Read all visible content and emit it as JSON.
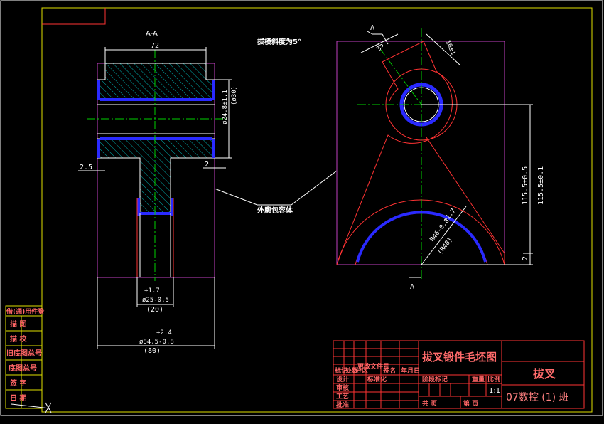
{
  "drawing": {
    "section_label": "A-A",
    "draft_note": "拔模斜度为5°",
    "envelope_note": "外廓包容体",
    "view_marker": "A"
  },
  "dimensions": {
    "top_width": "72",
    "diam_upper": "ø24.8±1.1",
    "diam_upper_ref": "(ø30)",
    "left_offset": "2.5",
    "right_offset": "2",
    "bore_tol": "+1.7",
    "bore_diam": "ø25-0.5",
    "bore_ref": "(20)",
    "outer_tol": "+2.4",
    "outer_diam": "ø84.5-0.8",
    "outer_ref": "(80)",
    "angle_left": "35",
    "angle_right": "10±1",
    "height_main": "115.5±0.5",
    "height_sub": "115.5±0.1",
    "radius_tol": "+1.7",
    "radius_main": "R46-0.8",
    "radius_ref": "(R48)",
    "bottom_offset": "2"
  },
  "title_block": {
    "drawing_title": "拔叉锻件毛坯图",
    "part_name": "拔叉",
    "class_name": "07数控 (1) 班",
    "col_mark": "标记",
    "col_count": "处数",
    "col_division": "分区",
    "col_doc": "更改文件号",
    "col_sign": "签名",
    "col_date": "年月日",
    "row_design": "设计",
    "row_standard": "标准化",
    "row_check": "审核",
    "row_process": "工艺",
    "row_approve": "批准",
    "stage_label": "阶段标记",
    "weight_label": "重量",
    "scale_label": "比例",
    "scale_value": "1:1",
    "sheets_total": "共    页",
    "sheet_no": "第    页"
  },
  "side_block": {
    "rows": [
      "借(通)用件登",
      "描 图",
      "描 校",
      "旧底图总号",
      "底图总号",
      "签 字",
      "日 期"
    ]
  }
}
